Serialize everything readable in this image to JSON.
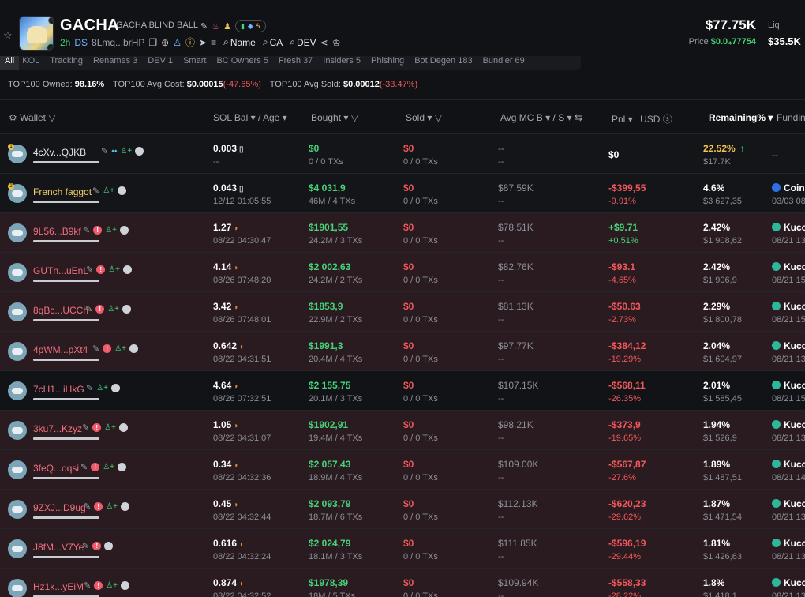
{
  "token": {
    "title": "GACHA",
    "subtitle": "GACHA BLIND BALL",
    "age": "2h",
    "ds": "DS",
    "address": "8Lmq...brHP",
    "search_name": "Name",
    "search_ca": "CA",
    "search_dev": "DEV",
    "price_main": "$77.75K",
    "price_label": "Price",
    "price_value": "$0.0₄77754",
    "liq_label": "Liq",
    "liq_value": "$35.5K"
  },
  "tabs": [
    "All",
    "KOL",
    "Tracking",
    "Renames 3",
    "DEV 1",
    "Smart",
    "BC Owners 5",
    "Fresh 37",
    "Insiders 5",
    "Phishing",
    "Bot Degen 183",
    "Bundler 69"
  ],
  "summary": {
    "owned_label": "TOP100 Owned:",
    "owned_value": "98.16%",
    "avg_cost_label": "TOP100 Avg Cost:",
    "avg_cost_value": "$0.00015",
    "avg_cost_change": "(-47.65%)",
    "avg_sold_label": "TOP100 Avg Sold:",
    "avg_sold_value": "$0.00012",
    "avg_sold_change": "(-33.47%)"
  },
  "columns": {
    "wallet": "Wallet",
    "sol_bal": "SOL Bal",
    "age": "Age",
    "bought": "Bought",
    "sold": "Sold",
    "avg_mc": "Avg MC B",
    "avg_mc_s": "S",
    "pnl": "Pnl",
    "usd": "USD",
    "remaining": "Remaining%",
    "funding": "Fundin"
  },
  "rows": [
    {
      "wallet": "4cXv...QJKB",
      "bal": "0.003",
      "age": "--",
      "bought": "$0",
      "bought_tx": "0 / 0 TXs",
      "sold": "$0",
      "sold_tx": "0 / 0 TXs",
      "avg_b": "--",
      "avg_s": "--",
      "pnl": "$0",
      "pnl_pct": "",
      "remaining": "22.52%",
      "remaining_usd": "$17.7K",
      "fund_name": "--",
      "fund_date": ""
    },
    {
      "wallet": "French faggot",
      "bal": "0.043",
      "age": "12/12 01:05:55",
      "bought": "$4 031,9",
      "bought_tx": "46M / 4 TXs",
      "sold": "$0",
      "sold_tx": "0 / 0 TXs",
      "avg_b": "$87.59K",
      "avg_s": "--",
      "pnl": "-$399,55",
      "pnl_pct": "-9.91%",
      "remaining": "4.6%",
      "remaining_usd": "$3 627,35",
      "fund_name": "Coinb",
      "fund_date": "03/03 08"
    },
    {
      "wallet": "9L56...B9kf",
      "bal": "1.27",
      "age": "08/22 04:30:47",
      "bought": "$1901,55",
      "bought_tx": "24.2M / 3 TXs",
      "sold": "$0",
      "sold_tx": "0 / 0 TXs",
      "avg_b": "$78.51K",
      "avg_s": "--",
      "pnl": "+$9.71",
      "pnl_pct": "+0.51%",
      "remaining": "2.42%",
      "remaining_usd": "$1 908,62",
      "fund_name": "Kuco",
      "fund_date": "08/21 13"
    },
    {
      "wallet": "GUTn...uEnL",
      "bal": "4.14",
      "age": "08/26 07:48:20",
      "bought": "$2 002,63",
      "bought_tx": "24.2M / 2 TXs",
      "sold": "$0",
      "sold_tx": "0 / 0 TXs",
      "avg_b": "$82.76K",
      "avg_s": "--",
      "pnl": "-$93.1",
      "pnl_pct": "-4.65%",
      "remaining": "2.42%",
      "remaining_usd": "$1 906,9",
      "fund_name": "Kuco",
      "fund_date": "08/21 15"
    },
    {
      "wallet": "8qBc...UCCh",
      "bal": "3.42",
      "age": "08/26 07:48:01",
      "bought": "$1853,9",
      "bought_tx": "22.9M / 2 TXs",
      "sold": "$0",
      "sold_tx": "0 / 0 TXs",
      "avg_b": "$81.13K",
      "avg_s": "--",
      "pnl": "-$50.63",
      "pnl_pct": "-2.73%",
      "remaining": "2.29%",
      "remaining_usd": "$1 800,78",
      "fund_name": "Kuco",
      "fund_date": "08/21 15"
    },
    {
      "wallet": "4pWM...pXt4",
      "bal": "0.642",
      "age": "08/22 04:31:51",
      "bought": "$1991,3",
      "bought_tx": "20.4M / 4 TXs",
      "sold": "$0",
      "sold_tx": "0 / 0 TXs",
      "avg_b": "$97.77K",
      "avg_s": "--",
      "pnl": "-$384,12",
      "pnl_pct": "-19.29%",
      "remaining": "2.04%",
      "remaining_usd": "$1 604,97",
      "fund_name": "Kuco",
      "fund_date": "08/21 13"
    },
    {
      "wallet": "7cH1...iHkG",
      "bal": "4.64",
      "age": "08/26 07:32:51",
      "bought": "$2 155,75",
      "bought_tx": "20.1M / 3 TXs",
      "sold": "$0",
      "sold_tx": "0 / 0 TXs",
      "avg_b": "$107.15K",
      "avg_s": "--",
      "pnl": "-$568,11",
      "pnl_pct": "-26.35%",
      "remaining": "2.01%",
      "remaining_usd": "$1 585,45",
      "fund_name": "Kuco",
      "fund_date": "08/21 15"
    },
    {
      "wallet": "3ku7...Kzyz",
      "bal": "1.05",
      "age": "08/22 04:31:07",
      "bought": "$1902,91",
      "bought_tx": "19.4M / 4 TXs",
      "sold": "$0",
      "sold_tx": "0 / 0 TXs",
      "avg_b": "$98.21K",
      "avg_s": "--",
      "pnl": "-$373,9",
      "pnl_pct": "-19.65%",
      "remaining": "1.94%",
      "remaining_usd": "$1 526,9",
      "fund_name": "Kuco",
      "fund_date": "08/21 13"
    },
    {
      "wallet": "3feQ...oqsi",
      "bal": "0.34",
      "age": "08/22 04:32:36",
      "bought": "$2 057,43",
      "bought_tx": "18.9M / 4 TXs",
      "sold": "$0",
      "sold_tx": "0 / 0 TXs",
      "avg_b": "$109.00K",
      "avg_s": "--",
      "pnl": "-$567,87",
      "pnl_pct": "-27.6%",
      "remaining": "1.89%",
      "remaining_usd": "$1 487,51",
      "fund_name": "Kuco",
      "fund_date": "08/21 14"
    },
    {
      "wallet": "9ZXJ...D9ug",
      "bal": "0.45",
      "age": "08/22 04:32:44",
      "bought": "$2 093,79",
      "bought_tx": "18.7M / 6 TXs",
      "sold": "$0",
      "sold_tx": "0 / 0 TXs",
      "avg_b": "$112.13K",
      "avg_s": "--",
      "pnl": "-$620,23",
      "pnl_pct": "-29.62%",
      "remaining": "1.87%",
      "remaining_usd": "$1 471,54",
      "fund_name": "Kuco",
      "fund_date": "08/21 13"
    },
    {
      "wallet": "J8fM...V7Ye",
      "bal": "0.616",
      "age": "08/22 04:32:24",
      "bought": "$2 024,79",
      "bought_tx": "18.1M / 3 TXs",
      "sold": "$0",
      "sold_tx": "0 / 0 TXs",
      "avg_b": "$111.85K",
      "avg_s": "--",
      "pnl": "-$596,19",
      "pnl_pct": "-29.44%",
      "remaining": "1.81%",
      "remaining_usd": "$1 426,63",
      "fund_name": "Kuco",
      "fund_date": "08/21 13"
    },
    {
      "wallet": "Hz1k...yEiM",
      "bal": "0.874",
      "age": "08/22 04:32:52",
      "bought": "$1978,39",
      "bought_tx": "18M / 5 TXs",
      "sold": "$0",
      "sold_tx": "0 / 0 TXs",
      "avg_b": "$109.94K",
      "avg_s": "--",
      "pnl": "-$558,33",
      "pnl_pct": "-28.22%",
      "remaining": "1.8%",
      "remaining_usd": "$1 418,1",
      "fund_name": "Kuco",
      "fund_date": "08/21 13"
    }
  ]
}
